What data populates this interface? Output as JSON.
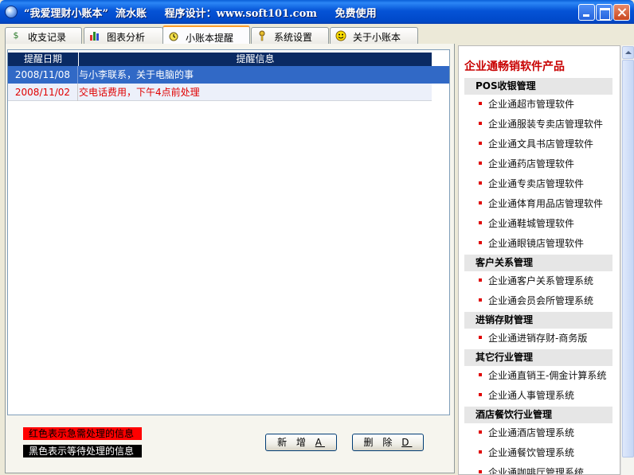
{
  "window": {
    "title": "“我爱理财小账本”  流水账     程序设计：www.soft101.com     免费使用"
  },
  "tabs": [
    {
      "label": "收支记录",
      "icon": "money-bag-icon"
    },
    {
      "label": "图表分析",
      "icon": "bar-chart-icon"
    },
    {
      "label": "小账本提醒",
      "icon": "alarm-clock-icon",
      "active": true
    },
    {
      "label": "系统设置",
      "icon": "key-icon"
    },
    {
      "label": "关于小账本",
      "icon": "smiley-icon"
    }
  ],
  "grid": {
    "columns": [
      "提醒日期",
      "提醒信息"
    ],
    "rows": [
      {
        "date": "2008/11/08",
        "info": "与小李联系，关于电脑的事",
        "state": "selected"
      },
      {
        "date": "2008/11/02",
        "info": "交电话费用，下午4点前处理",
        "state": "urgent"
      }
    ]
  },
  "legend": {
    "red": "红色表示急需处理的信息",
    "black": "黑色表示等待处理的信息"
  },
  "buttons": {
    "add_label": "新 增",
    "add_key": "A",
    "delete_label": "删 除",
    "delete_key": "D"
  },
  "sidebar": {
    "title": "企业通畅销软件产品",
    "categories": [
      {
        "name": "POS收银管理",
        "items": [
          "企业通超市管理软件",
          "企业通服装专卖店管理软件",
          "企业通文具书店管理软件",
          "企业通药店管理软件",
          "企业通专卖店管理软件",
          "企业通体育用品店管理软件",
          "企业通鞋城管理软件",
          "企业通眼镜店管理软件"
        ]
      },
      {
        "name": "客户关系管理",
        "items": [
          "企业通客户关系管理系统",
          "企业通会员会所管理系统"
        ]
      },
      {
        "name": "进销存财管理",
        "items": [
          "企业通进销存财-商务版"
        ]
      },
      {
        "name": "其它行业管理",
        "items": [
          "企业通直销王-佣金计算系统",
          "企业通人事管理系统"
        ]
      },
      {
        "name": "酒店餐饮行业管理",
        "items": [
          "企业通酒店管理系统",
          "企业通餐饮管理系统",
          "企业通咖啡厅管理系统"
        ]
      }
    ]
  },
  "colors": {
    "urgent": "#e00000",
    "selected": "#3169c6",
    "header": "#0a2a63",
    "sidebar_title": "#c80000"
  }
}
